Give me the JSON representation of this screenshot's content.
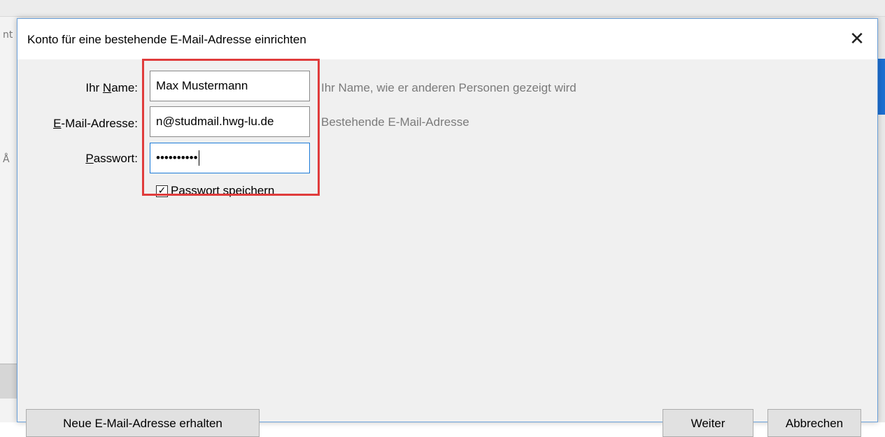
{
  "background": {
    "left_fragment_1": "nt",
    "left_fragment_2": "Å"
  },
  "dialog": {
    "title": "Konto für eine bestehende E-Mail-Adresse einrichten",
    "close_glyph": "✕"
  },
  "form": {
    "name": {
      "label_prefix": "Ihr ",
      "label_access": "N",
      "label_suffix": "ame:",
      "value": "Max Mustermann",
      "hint": "Ihr Name, wie er anderen Personen gezeigt wird"
    },
    "email": {
      "label_access": "E",
      "label_suffix": "-Mail-Adresse:",
      "value": "n@studmail.hwg-lu.de",
      "hint": "Bestehende E-Mail-Adresse"
    },
    "password": {
      "label_access": "P",
      "label_suffix": "asswort:",
      "value": "••••••••••"
    },
    "save_password": {
      "checked_glyph": "✓",
      "label_access": "P",
      "label_suffix": "asswort speichern"
    }
  },
  "buttons": {
    "new_address": "Neue E-Mail-Adresse erhalten",
    "next": "Weiter",
    "cancel": "Abbrechen"
  },
  "colors": {
    "highlight": "#e03c3c",
    "focus": "#1c7bd8",
    "hint_text": "#7a7a7a"
  }
}
